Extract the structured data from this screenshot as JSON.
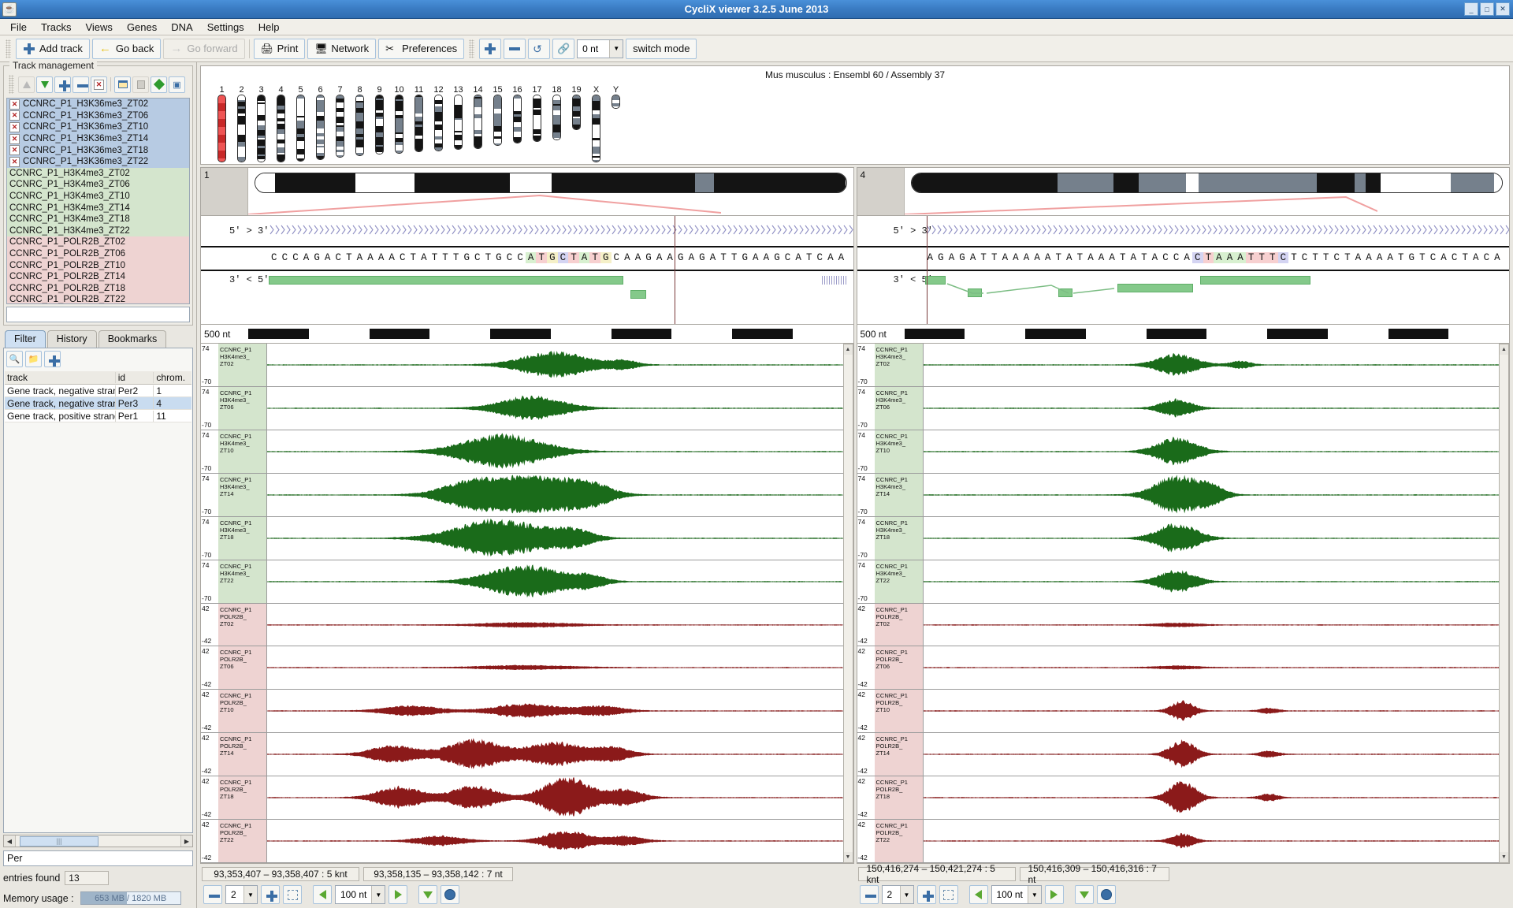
{
  "window": {
    "title": "CycliX viewer 3.2.5 June 2013",
    "app_icon": "java-coffee-icon",
    "minimize_label": "_",
    "maximize_label": "□",
    "close_label": "✕"
  },
  "menubar": {
    "items": [
      "File",
      "Tracks",
      "Views",
      "Genes",
      "DNA",
      "Settings",
      "Help"
    ]
  },
  "toolbar": {
    "add_track": "Add track",
    "go_back": "Go back",
    "go_forward": "Go forward",
    "print": "Print",
    "network": "Network",
    "preferences": "Preferences",
    "zoom_in_icon": "plus-icon",
    "zoom_out_icon": "minus-icon",
    "refresh_icon": "refresh-icon",
    "link_icon": "link-icon",
    "offset_value": "0 nt",
    "switch_mode": "switch mode"
  },
  "track_management": {
    "legend": "Track management",
    "tools": [
      "move-up-icon",
      "move-down-icon",
      "add-icon",
      "remove-icon",
      "delete-icon",
      "new-window-icon",
      "copy-icon",
      "expand-icon",
      "apply-icon"
    ],
    "tracks": [
      {
        "label": "CCNRC_P1_H3K36me3_ZT02",
        "group": "g1",
        "checkbox": true
      },
      {
        "label": "CCNRC_P1_H3K36me3_ZT06",
        "group": "g1",
        "checkbox": true
      },
      {
        "label": "CCNRC_P1_H3K36me3_ZT10",
        "group": "g1",
        "checkbox": true
      },
      {
        "label": "CCNRC_P1_H3K36me3_ZT14",
        "group": "g1",
        "checkbox": true
      },
      {
        "label": "CCNRC_P1_H3K36me3_ZT18",
        "group": "g1",
        "checkbox": true
      },
      {
        "label": "CCNRC_P1_H3K36me3_ZT22",
        "group": "g1",
        "checkbox": true
      },
      {
        "label": "CCNRC_P1_H3K4me3_ZT02",
        "group": "g2",
        "checkbox": false
      },
      {
        "label": "CCNRC_P1_H3K4me3_ZT06",
        "group": "g2",
        "checkbox": false
      },
      {
        "label": "CCNRC_P1_H3K4me3_ZT10",
        "group": "g2",
        "checkbox": false
      },
      {
        "label": "CCNRC_P1_H3K4me3_ZT14",
        "group": "g2",
        "checkbox": false
      },
      {
        "label": "CCNRC_P1_H3K4me3_ZT18",
        "group": "g2",
        "checkbox": false
      },
      {
        "label": "CCNRC_P1_H3K4me3_ZT22",
        "group": "g2",
        "checkbox": false
      },
      {
        "label": "CCNRC_P1_POLR2B_ZT02",
        "group": "g3",
        "checkbox": false
      },
      {
        "label": "CCNRC_P1_POLR2B_ZT06",
        "group": "g3",
        "checkbox": false
      },
      {
        "label": "CCNRC_P1_POLR2B_ZT10",
        "group": "g3",
        "checkbox": false
      },
      {
        "label": "CCNRC_P1_POLR2B_ZT14",
        "group": "g3",
        "checkbox": false
      },
      {
        "label": "CCNRC_P1_POLR2B_ZT18",
        "group": "g3",
        "checkbox": false
      },
      {
        "label": "CCNRC_P1_POLR2B_ZT22",
        "group": "g3",
        "checkbox": false
      }
    ]
  },
  "side_tabs": {
    "items": [
      "Filter",
      "History",
      "Bookmarks"
    ],
    "active": "Filter"
  },
  "filter": {
    "tools": [
      "search-icon",
      "open-icon",
      "add-icon"
    ],
    "columns": [
      "track",
      "id",
      "chrom."
    ],
    "rows": [
      {
        "track": "Gene track, negative strand",
        "id": "Per2",
        "chrom": "1",
        "selected": false
      },
      {
        "track": "Gene track, negative strand",
        "id": "Per3",
        "chrom": "4",
        "selected": true
      },
      {
        "track": "Gene track, positive strand",
        "id": "Per1",
        "chrom": "11",
        "selected": false
      }
    ],
    "query": "Per",
    "entries_label": "entries found",
    "entries_count": "13"
  },
  "memory": {
    "label": "Memory usage :",
    "value": "653 MB / 1820 MB",
    "percent": 36
  },
  "karyotype": {
    "assembly": "Mus musculus : Ensembl 60 / Assembly 37",
    "selected": "1",
    "selected_color": "#e03a3a",
    "chromosomes": [
      "1",
      "2",
      "3",
      "4",
      "5",
      "6",
      "7",
      "8",
      "9",
      "10",
      "11",
      "12",
      "13",
      "14",
      "15",
      "16",
      "17",
      "18",
      "19",
      "X",
      "Y"
    ]
  },
  "views": [
    {
      "chromosome": "1",
      "strand_fwd_label": "5' > 3'",
      "strand_rev_label": "3' < 5'",
      "sequence": "CCCAGACTAAAACTATTTGCTGCCATGCTATGCAAGAAGAGATTGAAGCATCAA",
      "ruler_unit": "500 nt",
      "position_range": "93,353,407 – 93,358,407 : 5 knt",
      "position_cursor": "93,358,135 – 93,358,142 : 7 nt",
      "zoom_level": "2",
      "step_size": "100 nt"
    },
    {
      "chromosome": "4",
      "strand_fwd_label": "5' > 3'",
      "strand_rev_label": "3' < 5'",
      "sequence": "AGAGATTAAAAATATAAATATACCACTAAATTTCTCTTCTAAAATGTCACTACA",
      "ruler_unit": "500 nt",
      "position_range": "150,416,274 – 150,421,274 : 5 knt",
      "position_cursor": "150,416,309 – 150,416,316 : 7 nt",
      "zoom_level": "2",
      "step_size": "100 nt"
    }
  ],
  "data_tracks": [
    {
      "name_line1": "CCNRC_P1",
      "name_line2": "H3K4me3_",
      "name_line3": "ZT02",
      "group": "g2",
      "max": "74",
      "min": "-70",
      "color": "#1a6b1a"
    },
    {
      "name_line1": "CCNRC_P1",
      "name_line2": "H3K4me3_",
      "name_line3": "ZT06",
      "group": "g2",
      "max": "74",
      "min": "-70",
      "color": "#1a6b1a"
    },
    {
      "name_line1": "CCNRC_P1",
      "name_line2": "H3K4me3_",
      "name_line3": "ZT10",
      "group": "g2",
      "max": "74",
      "min": "-70",
      "color": "#1a6b1a"
    },
    {
      "name_line1": "CCNRC_P1",
      "name_line2": "H3K4me3_",
      "name_line3": "ZT14",
      "group": "g2",
      "max": "74",
      "min": "-70",
      "color": "#1a6b1a"
    },
    {
      "name_line1": "CCNRC_P1",
      "name_line2": "H3K4me3_",
      "name_line3": "ZT18",
      "group": "g2",
      "max": "74",
      "min": "-70",
      "color": "#1a6b1a"
    },
    {
      "name_line1": "CCNRC_P1",
      "name_line2": "H3K4me3_",
      "name_line3": "ZT22",
      "group": "g2",
      "max": "74",
      "min": "-70",
      "color": "#1a6b1a"
    },
    {
      "name_line1": "CCNRC_P1",
      "name_line2": "POLR2B_",
      "name_line3": "ZT02",
      "group": "g3",
      "max": "42",
      "min": "-42",
      "color": "#8b1a1a"
    },
    {
      "name_line1": "CCNRC_P1",
      "name_line2": "POLR2B_",
      "name_line3": "ZT06",
      "group": "g3",
      "max": "42",
      "min": "-42",
      "color": "#8b1a1a"
    },
    {
      "name_line1": "CCNRC_P1",
      "name_line2": "POLR2B_",
      "name_line3": "ZT10",
      "group": "g3",
      "max": "42",
      "min": "-42",
      "color": "#8b1a1a"
    },
    {
      "name_line1": "CCNRC_P1",
      "name_line2": "POLR2B_",
      "name_line3": "ZT14",
      "group": "g3",
      "max": "42",
      "min": "-42",
      "color": "#8b1a1a"
    },
    {
      "name_line1": "CCNRC_P1",
      "name_line2": "POLR2B_",
      "name_line3": "ZT18",
      "group": "g3",
      "max": "42",
      "min": "-42",
      "color": "#8b1a1a"
    },
    {
      "name_line1": "CCNRC_P1",
      "name_line2": "POLR2B_",
      "name_line3": "ZT22",
      "group": "g3",
      "max": "42",
      "min": "-42",
      "color": "#8b1a1a"
    }
  ],
  "nav": {
    "zoom_out_icon": "minus-icon",
    "zoom_in_icon": "plus-icon",
    "fit_icon": "fit-icon",
    "prev_icon": "arrow-left-icon",
    "next_icon": "arrow-right-icon",
    "down_icon": "arrow-down-icon",
    "globe_icon": "globe-icon"
  }
}
